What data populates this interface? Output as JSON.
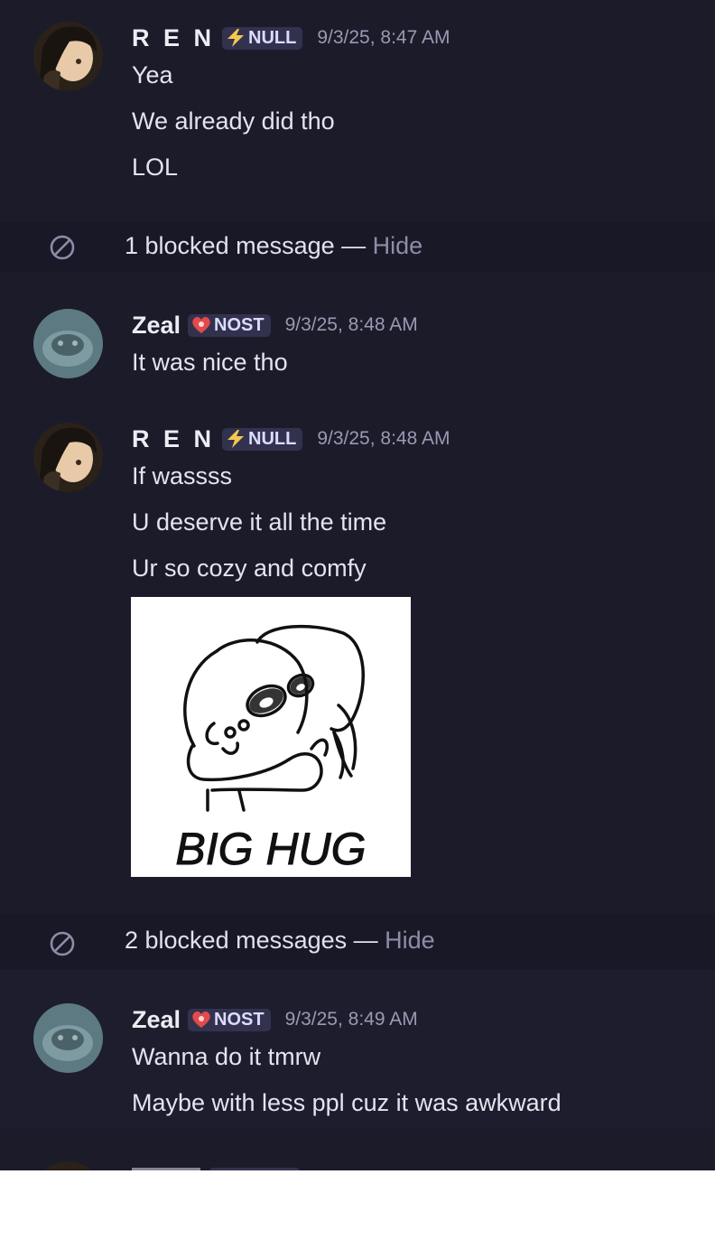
{
  "colors": {
    "background": "#1c1b2a",
    "blocked_row": "#191827",
    "tag_background": "#33324e",
    "muted_text": "#9a99b3",
    "lightning": "#f2c94c",
    "nost_heart": "#e24b4b"
  },
  "groups": [
    {
      "author": "R E N",
      "tag": {
        "icon": "lightning-icon",
        "label": "NULL"
      },
      "timestamp": "9/3/25, 8:47 AM",
      "lines": [
        "Yea",
        "We already did tho",
        "LOL"
      ]
    },
    {
      "author": "Zeal",
      "tag": {
        "icon": "heart-icon",
        "label": "NOST"
      },
      "timestamp": "9/3/25, 8:48 AM",
      "lines": [
        "It was nice tho"
      ]
    },
    {
      "author": "R E N",
      "tag": {
        "icon": "lightning-icon",
        "label": "NULL"
      },
      "timestamp": "9/3/25, 8:48 AM",
      "lines": [
        "If wassss",
        "U deserve it all the time",
        "Ur so cozy and comfy"
      ],
      "attachment": {
        "caption": "BIG HUG"
      }
    },
    {
      "author": "Zeal",
      "tag": {
        "icon": "heart-icon",
        "label": "NOST"
      },
      "timestamp": "9/3/25, 8:49 AM",
      "lines": [
        "Wanna do it tmrw",
        "Maybe with less ppl cuz it was awkward"
      ]
    }
  ],
  "blocked": [
    {
      "text": "1 blocked message —",
      "action": "Hide"
    },
    {
      "text": "2 blocked messages —",
      "action": "Hide"
    }
  ]
}
